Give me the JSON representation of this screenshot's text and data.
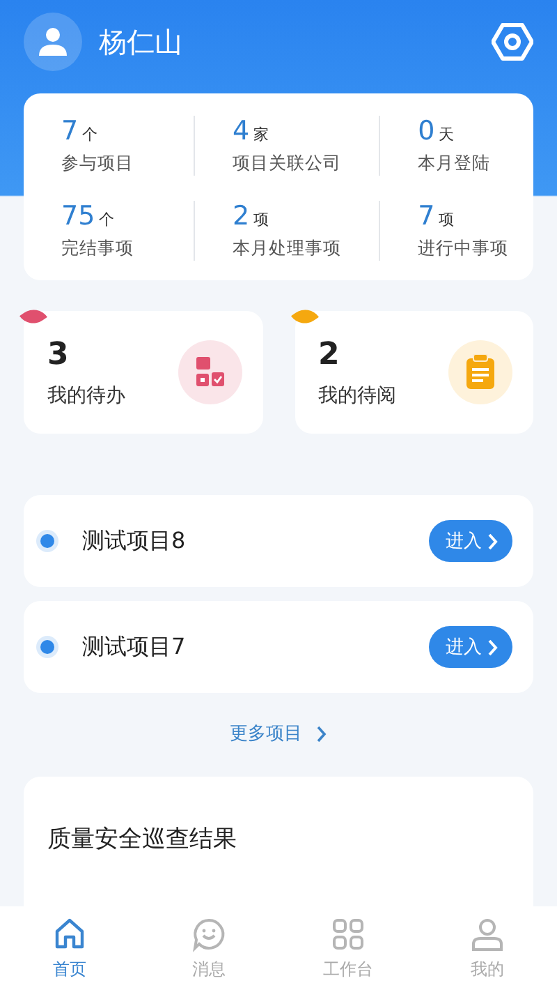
{
  "header": {
    "user_name": "杨仁山"
  },
  "stats": [
    {
      "value": "7",
      "unit": "个",
      "label": "参与项目"
    },
    {
      "value": "4",
      "unit": "家",
      "label": "项目关联公司"
    },
    {
      "value": "0",
      "unit": "天",
      "label": "本月登陆"
    },
    {
      "value": "75",
      "unit": "个",
      "label": "完结事项"
    },
    {
      "value": "2",
      "unit": "项",
      "label": "本月处理事项"
    },
    {
      "value": "7",
      "unit": "项",
      "label": "进行中事项"
    }
  ],
  "tasks": [
    {
      "kind": "todo",
      "count": "3",
      "label": "我的待办",
      "color": "#e0506e"
    },
    {
      "kind": "read",
      "count": "2",
      "label": "我的待阅",
      "color": "#f5a80f"
    }
  ],
  "projects": [
    {
      "name": "测试项目8",
      "button": "进入"
    },
    {
      "name": "测试项目7",
      "button": "进入"
    }
  ],
  "more_link": "更多项目",
  "report": {
    "title": "质量安全巡查结果"
  },
  "tab_bar": [
    {
      "kind": "home",
      "label": "首页",
      "selected": true
    },
    {
      "kind": "message",
      "label": "消息",
      "selected": false
    },
    {
      "kind": "workbench",
      "label": "工作台",
      "selected": false
    },
    {
      "kind": "profile",
      "label": "我的",
      "selected": false
    }
  ]
}
